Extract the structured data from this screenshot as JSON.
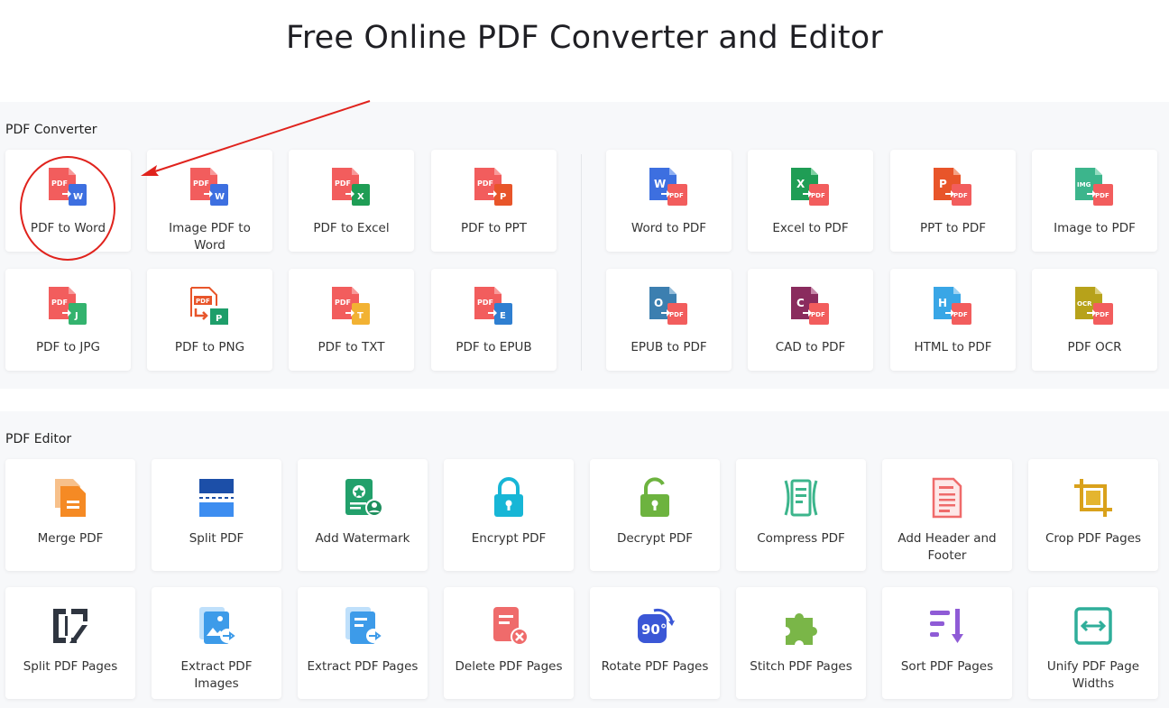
{
  "page": {
    "title": "Free Online PDF Converter and Editor"
  },
  "colors": {
    "pdf_red": "#f25d5d",
    "word_blue": "#3d6fe0",
    "excel_green": "#1f9d55",
    "ppt_orange": "#e8552a",
    "img_teal": "#3cb58c",
    "jpg_green": "#33b36e",
    "png_green": "#1e9e6a",
    "txt_yellow": "#f2b233",
    "epub_blue": "#2f7fd1",
    "epub_teal": "#3c7fb0",
    "cad_purple": "#8a2c5e",
    "html_blue": "#39a6e6",
    "ocr_olive": "#b7a21a",
    "annotation_red": "#e0231d"
  },
  "converter": {
    "title": "PDF Converter",
    "tools": [
      {
        "label": "PDF to Word",
        "icon": "pdf-to-word-icon",
        "letter": "W"
      },
      {
        "label": "Image PDF to Word",
        "icon": "image-pdf-to-word-icon",
        "letter": "W"
      },
      {
        "label": "PDF to Excel",
        "icon": "pdf-to-excel-icon",
        "letter": "X"
      },
      {
        "label": "PDF to PPT",
        "icon": "pdf-to-ppt-icon",
        "letter": "P"
      },
      {
        "label": "Word to PDF",
        "icon": "word-to-pdf-icon",
        "letter": "W"
      },
      {
        "label": "Excel to PDF",
        "icon": "excel-to-pdf-icon",
        "letter": "X"
      },
      {
        "label": "PPT to PDF",
        "icon": "ppt-to-pdf-icon",
        "letter": "P"
      },
      {
        "label": "Image to PDF",
        "icon": "image-to-pdf-icon",
        "letter": "IMG"
      },
      {
        "label": "PDF to JPG",
        "icon": "pdf-to-jpg-icon",
        "letter": "J"
      },
      {
        "label": "PDF to PNG",
        "icon": "pdf-to-png-icon",
        "letter": "P"
      },
      {
        "label": "PDF to TXT",
        "icon": "pdf-to-txt-icon",
        "letter": "T"
      },
      {
        "label": "PDF to EPUB",
        "icon": "pdf-to-epub-icon",
        "letter": "E"
      },
      {
        "label": "EPUB to PDF",
        "icon": "epub-to-pdf-icon",
        "letter": "O"
      },
      {
        "label": "CAD to PDF",
        "icon": "cad-to-pdf-icon",
        "letter": "C"
      },
      {
        "label": "HTML to PDF",
        "icon": "html-to-pdf-icon",
        "letter": "H"
      },
      {
        "label": "PDF OCR",
        "icon": "pdf-ocr-icon",
        "letter": "OCR"
      }
    ],
    "badge_pdf": "PDF"
  },
  "editor": {
    "title": "PDF Editor",
    "tools": [
      {
        "label": "Merge PDF",
        "icon": "merge-pdf-icon"
      },
      {
        "label": "Split PDF",
        "icon": "split-pdf-icon"
      },
      {
        "label": "Add Watermark",
        "icon": "add-watermark-icon"
      },
      {
        "label": "Encrypt PDF",
        "icon": "encrypt-pdf-icon"
      },
      {
        "label": "Decrypt PDF",
        "icon": "decrypt-pdf-icon"
      },
      {
        "label": "Compress PDF",
        "icon": "compress-pdf-icon"
      },
      {
        "label": "Add Header and Footer",
        "icon": "add-header-footer-icon"
      },
      {
        "label": "Crop PDF Pages",
        "icon": "crop-pdf-pages-icon"
      },
      {
        "label": "Split PDF Pages",
        "icon": "split-pdf-pages-icon"
      },
      {
        "label": "Extract PDF Images",
        "icon": "extract-pdf-images-icon"
      },
      {
        "label": "Extract PDF Pages",
        "icon": "extract-pdf-pages-icon"
      },
      {
        "label": "Delete PDF Pages",
        "icon": "delete-pdf-pages-icon"
      },
      {
        "label": "Rotate PDF Pages",
        "icon": "rotate-pdf-pages-icon",
        "badge": "90°"
      },
      {
        "label": "Stitch PDF Pages",
        "icon": "stitch-pdf-pages-icon"
      },
      {
        "label": "Sort PDF Pages",
        "icon": "sort-pdf-pages-icon"
      },
      {
        "label": "Unify PDF Page Widths",
        "icon": "unify-pdf-page-widths-icon"
      }
    ]
  }
}
